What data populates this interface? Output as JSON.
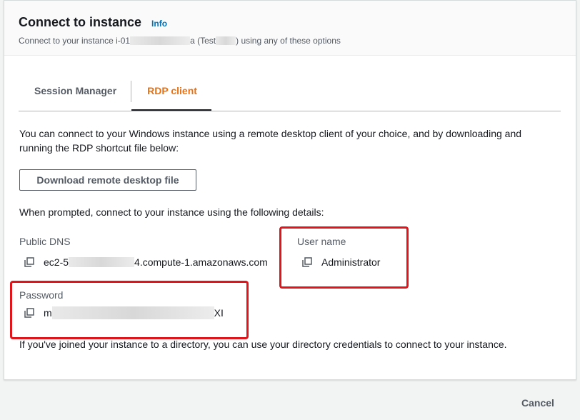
{
  "header": {
    "title": "Connect to instance",
    "info_link": "Info",
    "subtitle_prefix": "Connect to your instance i-01",
    "subtitle_mid": "a (Test",
    "subtitle_suffix": ") using any of these options"
  },
  "tabs": [
    {
      "label": "Session Manager",
      "active": false
    },
    {
      "label": "RDP client",
      "active": true
    }
  ],
  "rdp": {
    "intro": "You can connect to your Windows instance using a remote desktop client of your choice, and by downloading and running the RDP shortcut file below:",
    "download_button": "Download remote desktop file",
    "prompt": "When prompted, connect to your instance using the following details:",
    "public_dns": {
      "label": "Public DNS",
      "value_start": "ec2-5",
      "value_end": "4.compute-1.amazonaws.com"
    },
    "user_name": {
      "label": "User name",
      "value": "Administrator"
    },
    "password": {
      "label": "Password",
      "value_start": "m",
      "value_end": "XI"
    },
    "directory_note": "If you've joined your instance to a directory, you can use your directory credentials to connect to your instance."
  },
  "footer": {
    "cancel": "Cancel"
  },
  "colors": {
    "accent_tab": "#ec7211",
    "link": "#0073bb",
    "highlight": "#e0151b"
  },
  "icons": {
    "copy": "copy-icon"
  }
}
